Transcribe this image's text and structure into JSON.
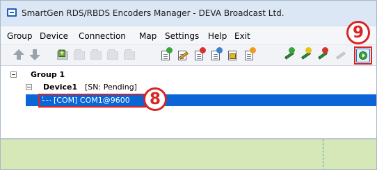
{
  "window": {
    "title": "SmartGen RDS/RBDS Encoders Manager - DEVA Broadcast Ltd.",
    "app_icon": "window-app-icon"
  },
  "menu": {
    "items": [
      "Group",
      "Device",
      "Connection",
      "Map",
      "Settings",
      "Help",
      "Exit"
    ]
  },
  "toolbar": {
    "buttons": [
      "move-up-icon",
      "move-down-icon",
      "new-group-icon",
      "group-icon",
      "group-icon",
      "group-icon",
      "group-icon",
      "add-device-icon",
      "edit-device-icon",
      "delete-device-icon",
      "device-settings-icon",
      "lock-device-icon",
      "device-alert-icon",
      "add-connection-icon",
      "edit-connection-icon",
      "delete-connection-icon",
      "connection-disabled-icon",
      "connect-start-icon"
    ]
  },
  "tree": {
    "group_label": "Group 1",
    "device_label": "Device1",
    "device_sn": "[SN: Pending]",
    "connection_label": "[COM] COM1@9600"
  },
  "callouts": {
    "connection_marker": "8",
    "start_button_marker": "9"
  },
  "colors": {
    "selection": "#0a66d6",
    "lower_panel": "#d6e8b8",
    "callout": "#d92424"
  }
}
